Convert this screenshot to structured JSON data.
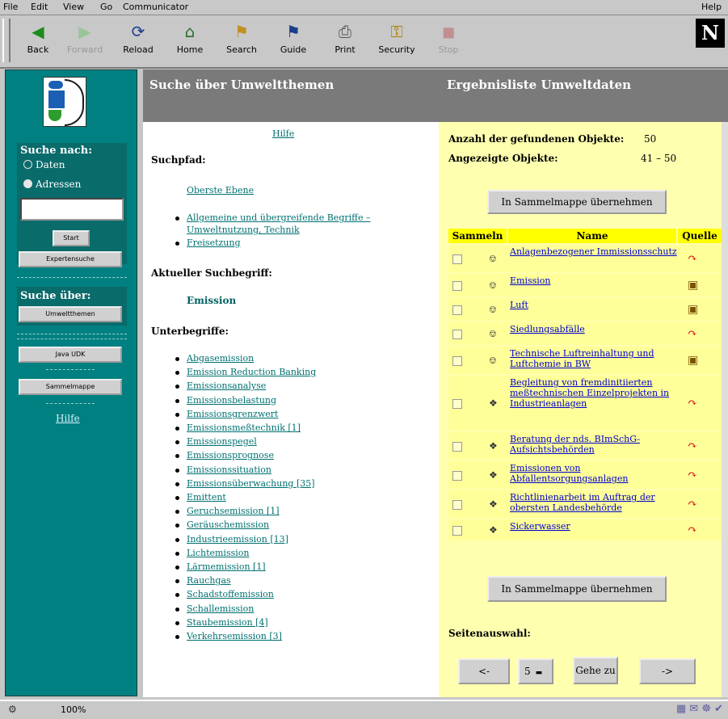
{
  "menu": [
    "File",
    "Edit",
    "View",
    "Go",
    "Communicator"
  ],
  "menu_help": "Help",
  "toolbar": [
    {
      "label": "Back",
      "icon": "back-arrow-icon"
    },
    {
      "label": "Forward",
      "icon": "forward-arrow-icon"
    },
    {
      "label": "Reload",
      "icon": "reload-icon"
    },
    {
      "label": "Home",
      "icon": "home-icon"
    },
    {
      "label": "Search",
      "icon": "search-icon"
    },
    {
      "label": "Guide",
      "icon": "guide-icon"
    },
    {
      "label": "Print",
      "icon": "printer-icon"
    },
    {
      "label": "Security",
      "icon": "lock-icon"
    },
    {
      "label": "Stop",
      "icon": "stop-icon"
    }
  ],
  "logo_letter": "N",
  "sidebar": {
    "search_title": "Suche nach:",
    "radio_data": "Daten",
    "radio_addresses": "Adressen",
    "start_button": "Start",
    "expert_button": "Expertensuche",
    "search_over_title": "Suche über:",
    "environment_button": "Umweltthemen",
    "java_button": "Java UDK",
    "collection_button": "Sammelmappe",
    "help_link": "Hilfe"
  },
  "middle": {
    "header": "Suche über Umweltthemen",
    "help_link": "Hilfe",
    "searchpath_label": "Suchpfad:",
    "top_level_link": "Oberste Ebene",
    "path_items": [
      "Allgemeine und übergreifende Begriffe –",
      "Umweltnutzung, Technik",
      "Freisetzung"
    ],
    "current_term_label": "Aktueller Suchbegriff:",
    "current_term": "Emission",
    "subterms_label": "Unterbegriffe:",
    "subterms": [
      "Abgasemission",
      "Emission Reduction Banking",
      "Emissionsanalyse",
      "Emissionsbelastung",
      "Emissionsgrenzwert",
      "Emissionsmeßtechnik [1]",
      "Emissionspegel",
      "Emissionsprognose",
      "Emissionssituation",
      "Emissionsüberwachung [35]",
      "Emittent",
      "Geruchsemission [1]",
      "Geräuschemission",
      "Industrieemission [13]",
      "Lichtemission",
      "Lärmemission [1]",
      "Rauchgas",
      "Schadstoffemission",
      "Schallemission",
      "Staubemission [4]",
      "Verkehrsemission [3]"
    ]
  },
  "right": {
    "header": "Ergebnisliste Umweltdaten",
    "found_label": "Anzahl der gefundenen Objekte:",
    "found_value": "50",
    "shown_label": "Angezeigte Objekte:",
    "shown_value": "41 – 50",
    "collect_button": "In Sammelmappe übernehmen",
    "col_collect": "Sammeln",
    "col_name": "Name",
    "col_source": "Quelle",
    "rows": [
      {
        "name": "Anlagenbezogener Immissionsschutz",
        "source": "red"
      },
      {
        "name": "Emission",
        "source": "brown"
      },
      {
        "name": "Luft",
        "source": "brown"
      },
      {
        "name": "Siedlungsabfälle",
        "source": "red"
      },
      {
        "name": "Technische Luftreinhaltung und Luftchemie in BW",
        "source": "brown"
      },
      {
        "name": "Begleitung von fremdinitiierten meßtechnischen Einzelprojekten in Industrieanlagen",
        "source": "red"
      },
      {
        "name": "Beratung der nds. BImSchG-Aufsichtsbehörden",
        "source": "red"
      },
      {
        "name": "Emissionen von Abfallentsorgungsanlagen",
        "source": "red"
      },
      {
        "name": "Richtlinienarbeit im Auftrag der obersten Landesbehörde",
        "source": "red"
      },
      {
        "name": "Sickerwasser",
        "source": "red"
      }
    ],
    "page_select_label": "Seitenauswahl:",
    "prev_button": "<-",
    "page_value": "5",
    "goto_button": "Gehe zu",
    "next_button": "->"
  },
  "status": {
    "zoom": "100%"
  },
  "colors": {
    "teal": "#008080",
    "yellow_panel": "#ffffb0",
    "header_gray": "#7a7a7a",
    "link_teal": "#007070"
  }
}
